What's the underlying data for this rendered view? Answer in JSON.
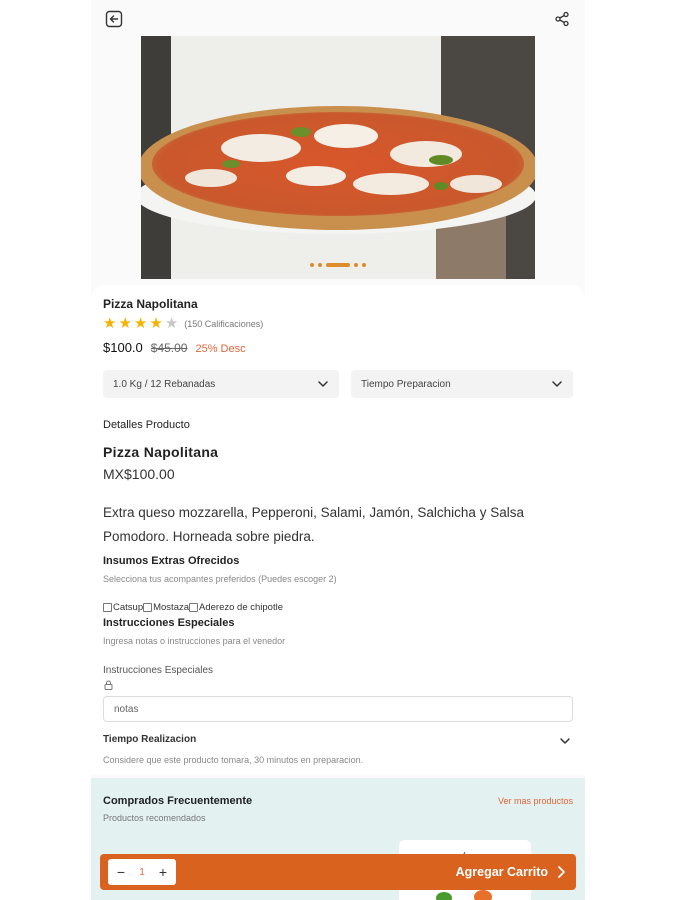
{
  "product": {
    "name": "Pizza Napolitana",
    "rating": 4,
    "rating_max": 5,
    "rating_count": "(150 Calificaciones)",
    "price": "$100.0",
    "old_price": "$45.00",
    "discount": "25% Desc",
    "gallery_pages": 5,
    "gallery_active": 3
  },
  "selects": {
    "size": "1.0 Kg / 12 Rebanadas",
    "prep_time": "Tiempo Preparacion"
  },
  "details": {
    "heading": "Detalles Producto",
    "title": "Pizza Napolitana",
    "price": "MX$100.00",
    "description": "Extra queso mozzarella, Pepperoni, Salami, Jamón, Salchicha y Salsa Pomodoro. Horneada sobre piedra."
  },
  "extras": {
    "title": "Insumos Extras Ofrecidos",
    "subtitle": "Selecciona tus acompantes preferidos (Puedes escoger 2)",
    "options": [
      "Catsup",
      "Mostaza",
      "Aderezo de chipotle"
    ]
  },
  "instructions": {
    "title": "Instrucciones Especiales",
    "subtitle": "Ingresa notas o instrucciones para el venedor",
    "field_label": "Instrucciones Especiales",
    "placeholder": "notas"
  },
  "time": {
    "title": "Tiempo Realizacion",
    "subtitle": "Considere que este producto tomara, 30 minutos en preparacion."
  },
  "frequent": {
    "title": "Comprados Frecuentemente",
    "subtitle": "Productos recomendados",
    "link": "Ver mas productos"
  },
  "cart": {
    "quantity": "1",
    "label": "Agregar Carrito"
  },
  "colors": {
    "accent": "#d9621e",
    "discount": "#e0673a",
    "star": "#f5b301",
    "section_bg": "#e4f1f1"
  }
}
